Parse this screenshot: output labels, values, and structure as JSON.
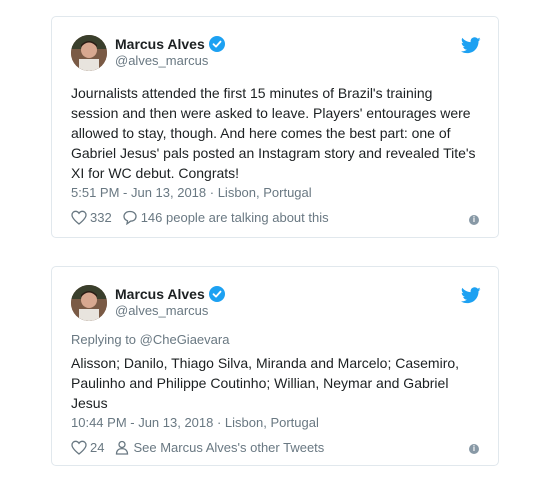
{
  "tweets": [
    {
      "author": {
        "name": "Marcus Alves",
        "handle": "@alves_marcus"
      },
      "text": "Journalists attended the first 15 minutes of Brazil's training session and then were asked to leave. Players' entourages were allowed to stay, though. And here comes the best part: one of Gabriel Jesus' pals posted an Instagram story and revealed Tite's XI for WC debut. Congrats!",
      "meta": "5:51 PM - Jun 13, 2018 · Lisbon, Portugal",
      "likes": "332",
      "secondary_action": "146 people are talking about this"
    },
    {
      "author": {
        "name": "Marcus Alves",
        "handle": "@alves_marcus"
      },
      "reply_to": "Replying to @CheGiaevara",
      "text": "Alisson; Danilo, Thiago Silva, Miranda and Marcelo; Casemiro, Paulinho and Philippe Coutinho; Willian, Neymar and Gabriel Jesus",
      "meta": "10:44 PM - Jun 13, 2018 · Lisbon, Portugal",
      "likes": "24",
      "secondary_action": "See Marcus Alves's other Tweets"
    }
  ],
  "colors": {
    "twitter_blue": "#1da1f2",
    "text": "#1c2022",
    "muted": "#697882",
    "border": "#e1e8ed"
  },
  "icons": [
    "avatar",
    "verified-icon",
    "twitter-bird-icon",
    "heart-icon",
    "comment-icon",
    "person-icon",
    "info-icon"
  ]
}
